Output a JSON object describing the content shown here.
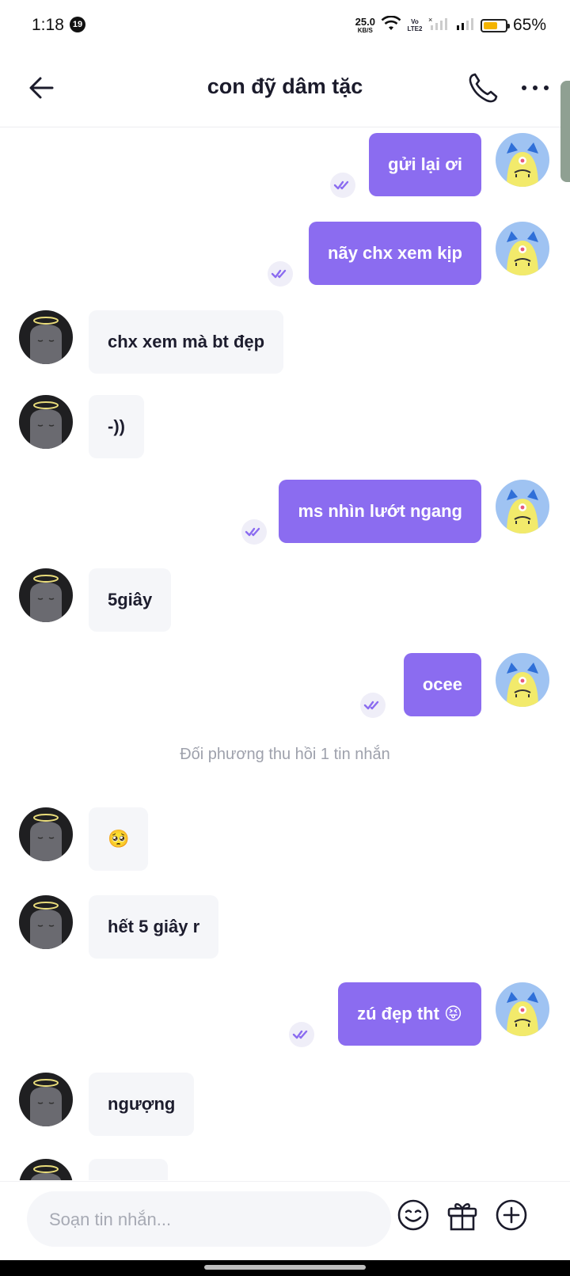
{
  "status_bar": {
    "time": "1:18",
    "notification_count": "19",
    "net_speed_value": "25.0",
    "net_speed_unit": "KB/S",
    "volte_label": "Vo LTE2",
    "battery_percent": "65%",
    "battery_level": 0.65,
    "battery_color": "#f4b400"
  },
  "header": {
    "title": "con đỹ dâm tặc",
    "back_icon": "arrow-left-icon",
    "call_icon": "phone-icon",
    "more_icon": "more-dots-icon"
  },
  "colors": {
    "outgoing_bubble": "#8b6cf0",
    "incoming_bubble": "#f5f6f9",
    "read_receipt": "#8b6cf0"
  },
  "messages": [
    {
      "sender": "me",
      "text": "gửi lại ơi",
      "read": true
    },
    {
      "sender": "me",
      "text": "nãy chx xem kịp",
      "read": true
    },
    {
      "sender": "them",
      "text": "chx xem mà bt đẹp"
    },
    {
      "sender": "them",
      "text": "-))"
    },
    {
      "sender": "me",
      "text": "ms nhìn lướt ngang",
      "read": true
    },
    {
      "sender": "them",
      "text": "5giây"
    },
    {
      "sender": "me",
      "text": "ocee",
      "read": true
    },
    {
      "sender": "system",
      "text": "Đối phương thu hồi 1 tin nhắn"
    },
    {
      "sender": "them",
      "text": "🥺"
    },
    {
      "sender": "them",
      "text": "hết 5 giây r"
    },
    {
      "sender": "me",
      "text": "zú đẹp tht 😝",
      "read": true
    },
    {
      "sender": "them",
      "text": "ngượng"
    }
  ],
  "composer": {
    "placeholder": "Soạn tin nhắn...",
    "value": "",
    "emoji_icon": "emoji-face-icon",
    "gift_icon": "gift-icon",
    "add_icon": "plus-circle-icon"
  }
}
